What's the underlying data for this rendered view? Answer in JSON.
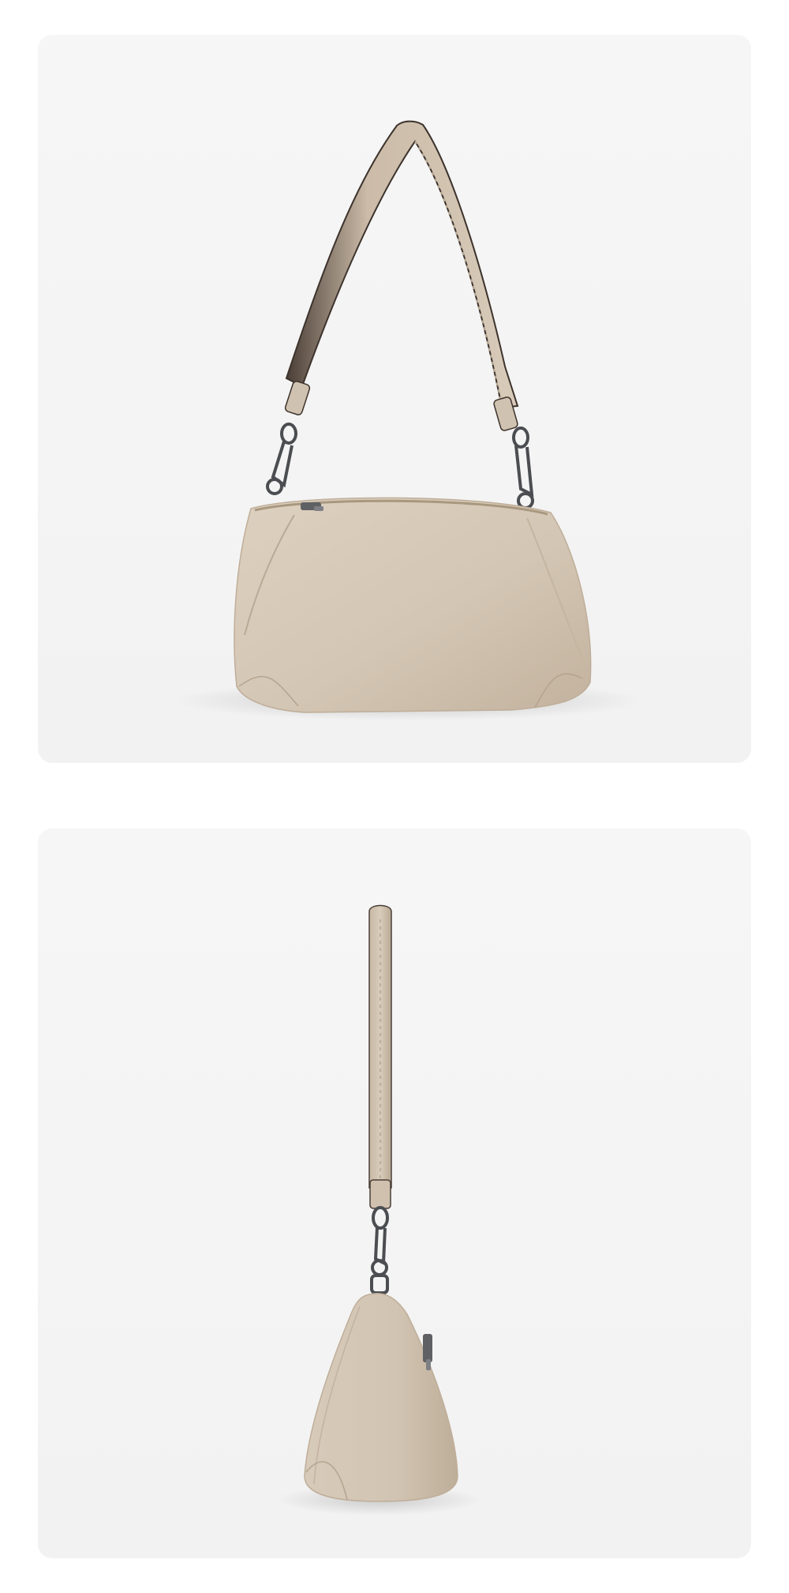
{
  "page": {
    "background": "#ffffff",
    "panel_background": "#f5f5f5"
  },
  "photos": [
    {
      "view": "three-quarter-front",
      "subject": "handbag",
      "colors": {
        "leather": "#d4c6b4",
        "leather_shadow": "#b9aa96",
        "strap_edge": "#4a3e36",
        "hardware": "#5e6064"
      }
    },
    {
      "view": "side-profile",
      "subject": "handbag",
      "colors": {
        "leather": "#d4c6b4",
        "leather_shadow": "#b9aa96",
        "strap_edge": "#4a3e36",
        "hardware": "#5e6064"
      }
    }
  ]
}
